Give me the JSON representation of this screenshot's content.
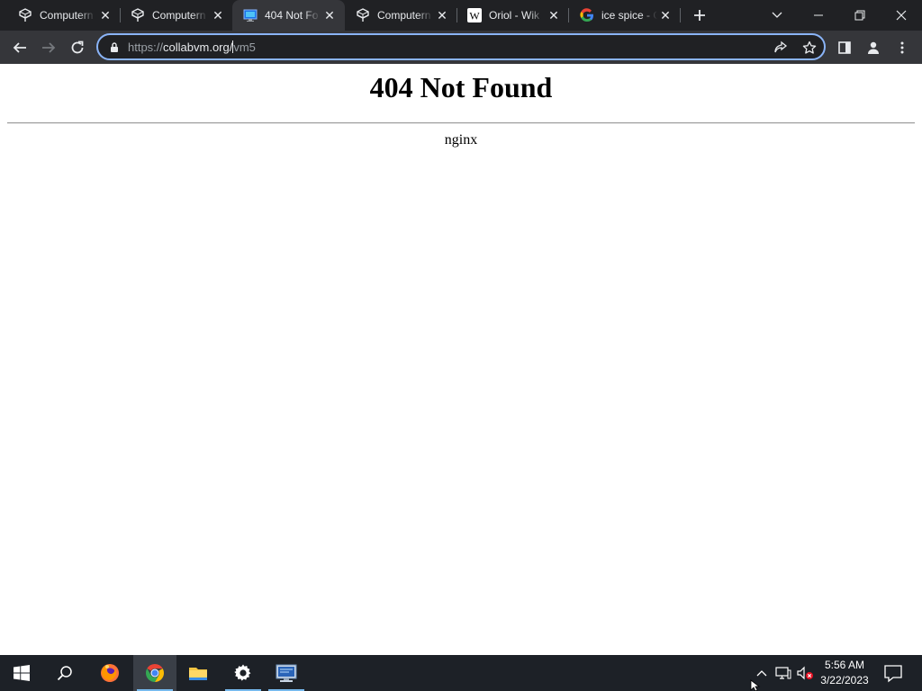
{
  "browser": {
    "tabs": [
      {
        "title": "Computern",
        "favicon": "collabvm-icon",
        "active": false
      },
      {
        "title": "Computern",
        "favicon": "collabvm-icon",
        "active": false
      },
      {
        "title": "404 Not Fo",
        "favicon": "monitor-icon",
        "active": true
      },
      {
        "title": "Computern",
        "favicon": "collabvm-icon",
        "active": false
      },
      {
        "title": "Oriol - Wik",
        "favicon": "wikipedia-icon",
        "active": false
      },
      {
        "title": "ice spice - G",
        "favicon": "google-icon",
        "active": false
      }
    ],
    "address": {
      "scheme": "https://",
      "host": "collabvm.org/",
      "path": "vm5"
    }
  },
  "page": {
    "heading": "404 Not Found",
    "server": "nginx"
  },
  "taskbar": {
    "pinned": [
      {
        "name": "start-button"
      },
      {
        "name": "search-button"
      },
      {
        "name": "firefox-app"
      },
      {
        "name": "chrome-app"
      },
      {
        "name": "file-explorer-app"
      },
      {
        "name": "settings-app"
      },
      {
        "name": "remote-desktop-app"
      }
    ],
    "clock": {
      "time": "5:56 AM",
      "date": "3/22/2023"
    }
  },
  "colors": {
    "tabstrip": "#202124",
    "toolbar": "#35363a",
    "omnibox_focus": "#8ab4f8",
    "taskbar": "#1d2127",
    "taskbar_running": "#76b9ed"
  }
}
